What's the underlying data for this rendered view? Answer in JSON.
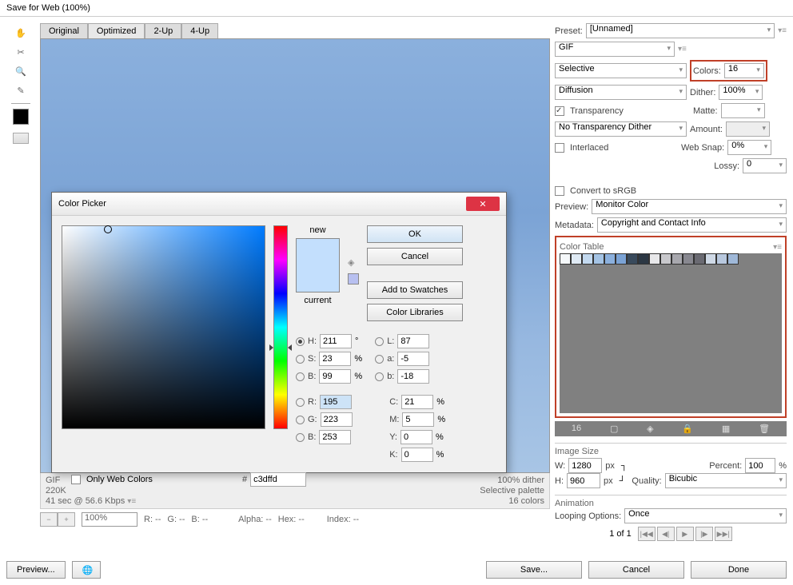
{
  "window": {
    "title": "Save for Web (100%)"
  },
  "tabs": [
    "Original",
    "Optimized",
    "2-Up",
    "4-Up"
  ],
  "activeTab": "Optimized",
  "info": {
    "format": "GIF",
    "size": "220K",
    "time": "41 sec @ 56.6 Kbps",
    "dither": "100% dither",
    "palette": "Selective palette",
    "colors": "16 colors"
  },
  "zoom": {
    "value": "100%",
    "r": "R: --",
    "g": "G: --",
    "b": "B: --",
    "alpha": "Alpha: --",
    "hex": "Hex: --",
    "index": "Index: --"
  },
  "preset": {
    "label": "Preset:",
    "value": "[Unnamed]",
    "format": "GIF",
    "reduction": "Selective",
    "colorsLabel": "Colors:",
    "colors": "16",
    "ditherAlg": "Diffusion",
    "ditherLabel": "Dither:",
    "dither": "100%",
    "transparency": "Transparency",
    "matteLabel": "Matte:",
    "matte": "",
    "transDither": "No Transparency Dither",
    "amountLabel": "Amount:",
    "amount": "",
    "interlaced": "Interlaced",
    "webSnapLabel": "Web Snap:",
    "webSnap": "0%",
    "lossyLabel": "Lossy:",
    "lossy": "0",
    "srgb": "Convert to sRGB",
    "previewLabel": "Preview:",
    "preview": "Monitor Color",
    "metadataLabel": "Metadata:",
    "metadata": "Copyright and Contact Info"
  },
  "colorTable": {
    "label": "Color Table",
    "count": "16",
    "swatches": [
      "#f5f8fa",
      "#dfeaf4",
      "#c3d9ef",
      "#a4c3e4",
      "#8bb0dd",
      "#7ba3d5",
      "#394a5c",
      "#2c3844",
      "#e8e8ea",
      "#c8c8cc",
      "#a8a8ae",
      "#888890",
      "#6a6a72",
      "#cfd9e6",
      "#b8c8de",
      "#9fb8d8"
    ]
  },
  "imageSize": {
    "label": "Image Size",
    "wLabel": "W:",
    "w": "1280",
    "hLabel": "H:",
    "h": "960",
    "px": "px",
    "percentLabel": "Percent:",
    "percent": "100",
    "pct": "%",
    "qualityLabel": "Quality:",
    "quality": "Bicubic"
  },
  "animation": {
    "label": "Animation",
    "loopLabel": "Looping Options:",
    "loop": "Once",
    "frame": "1 of 1"
  },
  "buttons": {
    "preview": "Preview...",
    "save": "Save...",
    "cancel": "Cancel",
    "done": "Done"
  },
  "colorPicker": {
    "title": "Color Picker",
    "newLabel": "new",
    "currentLabel": "current",
    "newColor": "#c3dffd",
    "currentColor": "#c3dffd",
    "ok": "OK",
    "cancel": "Cancel",
    "addSwatches": "Add to Swatches",
    "libraries": "Color Libraries",
    "onlyWeb": "Only Web Colors",
    "H": {
      "l": "H:",
      "v": "211",
      "u": "°"
    },
    "S": {
      "l": "S:",
      "v": "23",
      "u": "%"
    },
    "Br": {
      "l": "B:",
      "v": "99",
      "u": "%"
    },
    "R": {
      "l": "R:",
      "v": "195"
    },
    "G": {
      "l": "G:",
      "v": "223"
    },
    "Bl": {
      "l": "B:",
      "v": "253"
    },
    "L": {
      "l": "L:",
      "v": "87"
    },
    "a": {
      "l": "a:",
      "v": "-5"
    },
    "b": {
      "l": "b:",
      "v": "-18"
    },
    "C": {
      "l": "C:",
      "v": "21",
      "u": "%"
    },
    "M": {
      "l": "M:",
      "v": "5",
      "u": "%"
    },
    "Y": {
      "l": "Y:",
      "v": "0",
      "u": "%"
    },
    "K": {
      "l": "K:",
      "v": "0",
      "u": "%"
    },
    "hexLabel": "#",
    "hex": "c3dffd"
  }
}
